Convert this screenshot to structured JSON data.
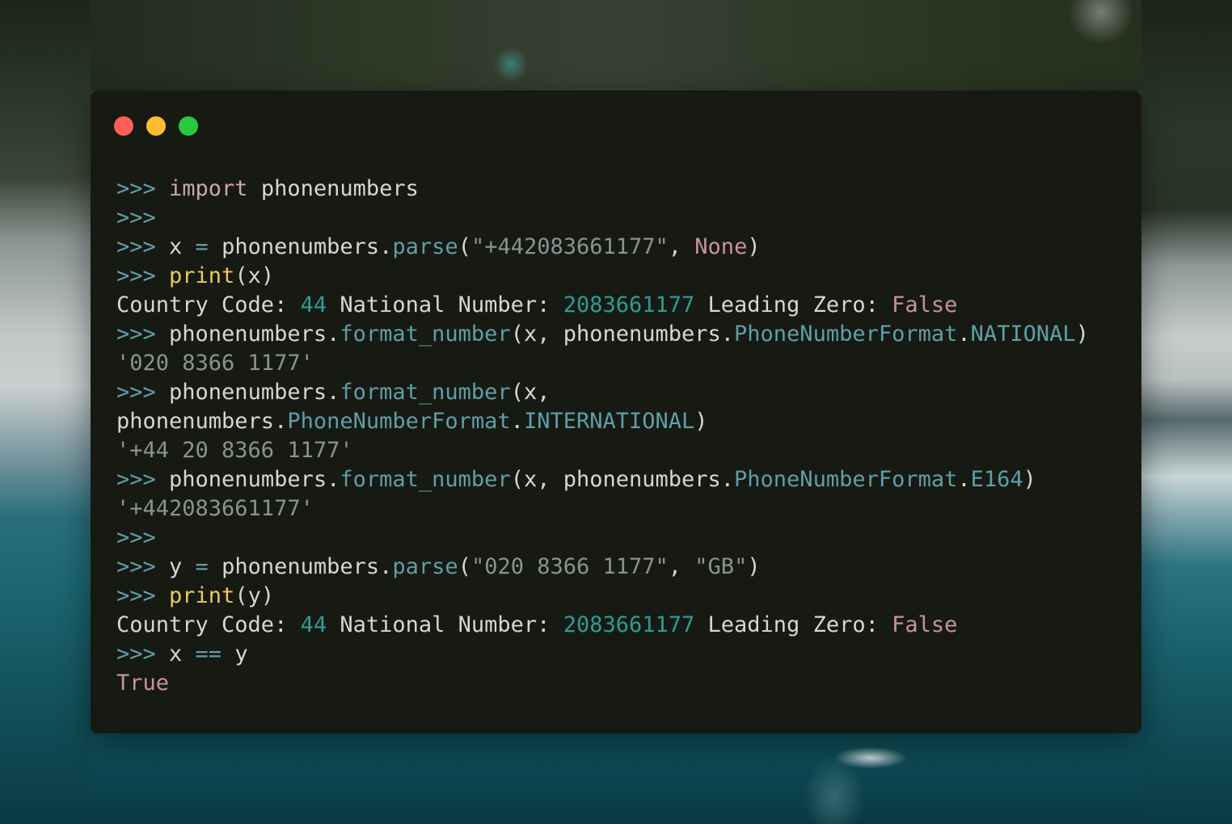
{
  "window": {
    "controls": [
      {
        "name": "close",
        "color": "#fe5f57"
      },
      {
        "name": "minimize",
        "color": "#febc2e"
      },
      {
        "name": "maximize",
        "color": "#28c840"
      }
    ]
  },
  "colors": {
    "window_bg": "#161a13",
    "prompt": "#5f9ea8",
    "keyword": "#cfa3ae",
    "builtin": "#f2c75a",
    "string": "#8c9194",
    "constant": "#c9929e",
    "number": "#2c9c95",
    "text": "#d6d8cf"
  },
  "console": {
    "lines": [
      [
        {
          "t": "prompt",
          "v": ">>> "
        },
        {
          "t": "keyword",
          "v": "import"
        },
        {
          "t": "text",
          "v": " phonenumbers"
        }
      ],
      [
        {
          "t": "prompt",
          "v": ">>>"
        }
      ],
      [
        {
          "t": "prompt",
          "v": ">>> "
        },
        {
          "t": "text",
          "v": "x "
        },
        {
          "t": "op",
          "v": "="
        },
        {
          "t": "text",
          "v": " phonenumbers."
        },
        {
          "t": "func",
          "v": "parse"
        },
        {
          "t": "text",
          "v": "("
        },
        {
          "t": "string",
          "v": "\"+442083661177\""
        },
        {
          "t": "text",
          "v": ", "
        },
        {
          "t": "const",
          "v": "None"
        },
        {
          "t": "text",
          "v": ")"
        }
      ],
      [
        {
          "t": "prompt",
          "v": ">>> "
        },
        {
          "t": "builtin",
          "v": "print"
        },
        {
          "t": "text",
          "v": "(x)"
        }
      ],
      [
        {
          "t": "text",
          "v": "Country Code: "
        },
        {
          "t": "number",
          "v": "44"
        },
        {
          "t": "text",
          "v": " National Number: "
        },
        {
          "t": "number",
          "v": "2083661177"
        },
        {
          "t": "text",
          "v": " Leading Zero: "
        },
        {
          "t": "const",
          "v": "False"
        }
      ],
      [
        {
          "t": "prompt",
          "v": ">>> "
        },
        {
          "t": "text",
          "v": "phonenumbers."
        },
        {
          "t": "func",
          "v": "format_number"
        },
        {
          "t": "text",
          "v": "(x, phonenumbers."
        },
        {
          "t": "func",
          "v": "PhoneNumberFormat"
        },
        {
          "t": "text",
          "v": "."
        },
        {
          "t": "func",
          "v": "NATIONAL"
        },
        {
          "t": "text",
          "v": ")"
        }
      ],
      [
        {
          "t": "string",
          "v": "'020 8366 1177'"
        }
      ],
      [
        {
          "t": "prompt",
          "v": ">>> "
        },
        {
          "t": "text",
          "v": "phonenumbers."
        },
        {
          "t": "func",
          "v": "format_number"
        },
        {
          "t": "text",
          "v": "(x,"
        }
      ],
      [
        {
          "t": "text",
          "v": "phonenumbers."
        },
        {
          "t": "func",
          "v": "PhoneNumberFormat"
        },
        {
          "t": "text",
          "v": "."
        },
        {
          "t": "func",
          "v": "INTERNATIONAL"
        },
        {
          "t": "text",
          "v": ")"
        }
      ],
      [
        {
          "t": "string",
          "v": "'+44 20 8366 1177'"
        }
      ],
      [
        {
          "t": "prompt",
          "v": ">>> "
        },
        {
          "t": "text",
          "v": "phonenumbers."
        },
        {
          "t": "func",
          "v": "format_number"
        },
        {
          "t": "text",
          "v": "(x, phonenumbers."
        },
        {
          "t": "func",
          "v": "PhoneNumberFormat"
        },
        {
          "t": "text",
          "v": "."
        },
        {
          "t": "func",
          "v": "E164"
        },
        {
          "t": "text",
          "v": ")"
        }
      ],
      [
        {
          "t": "string",
          "v": "'+442083661177'"
        }
      ],
      [
        {
          "t": "prompt",
          "v": ">>>"
        }
      ],
      [
        {
          "t": "prompt",
          "v": ">>> "
        },
        {
          "t": "text",
          "v": "y "
        },
        {
          "t": "op",
          "v": "="
        },
        {
          "t": "text",
          "v": " phonenumbers."
        },
        {
          "t": "func",
          "v": "parse"
        },
        {
          "t": "text",
          "v": "("
        },
        {
          "t": "string",
          "v": "\"020 8366 1177\""
        },
        {
          "t": "text",
          "v": ", "
        },
        {
          "t": "string",
          "v": "\"GB\""
        },
        {
          "t": "text",
          "v": ")"
        }
      ],
      [
        {
          "t": "prompt",
          "v": ">>> "
        },
        {
          "t": "builtin",
          "v": "print"
        },
        {
          "t": "text",
          "v": "(y)"
        }
      ],
      [
        {
          "t": "text",
          "v": "Country Code: "
        },
        {
          "t": "number",
          "v": "44"
        },
        {
          "t": "text",
          "v": " National Number: "
        },
        {
          "t": "number",
          "v": "2083661177"
        },
        {
          "t": "text",
          "v": " Leading Zero: "
        },
        {
          "t": "const",
          "v": "False"
        }
      ],
      [
        {
          "t": "prompt",
          "v": ">>> "
        },
        {
          "t": "text",
          "v": "x "
        },
        {
          "t": "op",
          "v": "=="
        },
        {
          "t": "text",
          "v": " y"
        }
      ],
      [
        {
          "t": "const",
          "v": "True"
        }
      ]
    ]
  }
}
